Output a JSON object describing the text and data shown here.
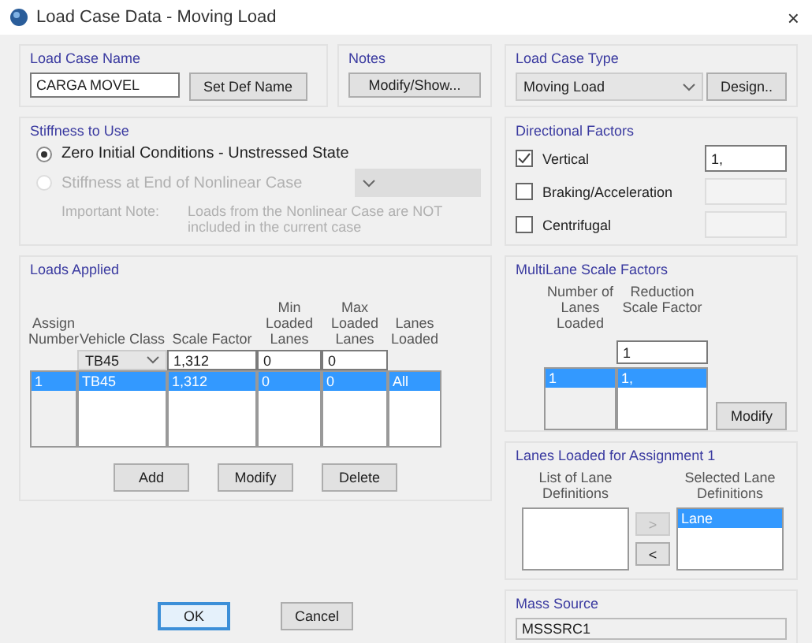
{
  "window": {
    "title": "Load Case Data - Moving Load",
    "close": "×"
  },
  "load_case_name": {
    "label": "Load Case Name",
    "value": "CARGA MOVEL",
    "button": "Set Def Name"
  },
  "notes": {
    "label": "Notes",
    "button": "Modify/Show..."
  },
  "stiffness": {
    "label": "Stiffness to Use",
    "options": [
      {
        "label": "Zero Initial Conditions - Unstressed State",
        "selected": true,
        "disabled": false
      },
      {
        "label": "Stiffness at End of Nonlinear Case",
        "selected": false,
        "disabled": true
      }
    ],
    "case_dropdown": {
      "disabled": true
    },
    "note_label": "Important Note:",
    "note": "Loads from the Nonlinear Case are NOT included in the current case"
  },
  "loads_applied": {
    "label": "Loads Applied",
    "columns": [
      "Assign Number",
      "Vehicle Class",
      "Scale Factor",
      "Min Loaded Lanes",
      "Max Loaded Lanes",
      "Lanes Loaded"
    ],
    "editor": {
      "vehicle": "TB45",
      "scale": "1,312",
      "min": "0",
      "max": "0"
    },
    "rows": [
      {
        "cells": [
          "1",
          "TB45",
          "1,312",
          "0",
          "0",
          "All"
        ],
        "selected": true
      }
    ],
    "buttons": [
      "Add",
      "Modify",
      "Delete"
    ]
  },
  "load_case_type": {
    "label": "Load Case Type",
    "value": "Moving Load",
    "button": "Design.."
  },
  "directional_factors": {
    "label": "Directional Factors",
    "items": [
      {
        "label": "Vertical",
        "checked": true,
        "value": "1,"
      },
      {
        "label": "Braking/Acceleration",
        "checked": false
      },
      {
        "label": "Centrifugal",
        "checked": false
      }
    ]
  },
  "multilane": {
    "label": "MultiLane Scale Factors",
    "columns": [
      "Number of Lanes Loaded",
      "Reduction Scale Factor"
    ],
    "editor": "1",
    "rows": [
      {
        "cells": [
          "1",
          "1,"
        ],
        "selected": true
      }
    ],
    "button": "Modify"
  },
  "lanes_loaded": {
    "label": "Lanes Loaded for Assignment 1",
    "list_label": "List of Lane Definitions",
    "selected_label": "Selected Lane Definitions",
    "selected_items": [
      {
        "label": "Lane",
        "selected": true
      }
    ],
    "add_button": {
      "label": ">",
      "disabled": true
    },
    "remove_button": {
      "label": "<",
      "disabled": false
    }
  },
  "mass_source": {
    "label": "Mass Source",
    "value": "MSSSRC1"
  },
  "buttons": [
    {
      "label": "OK",
      "default": true
    },
    {
      "label": "Cancel",
      "default": false
    }
  ]
}
